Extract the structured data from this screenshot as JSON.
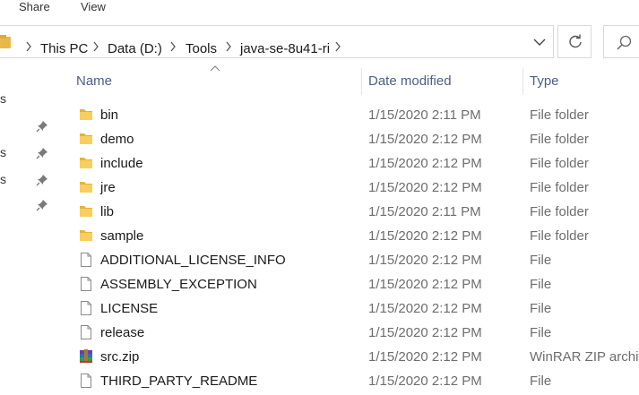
{
  "ribbon": {
    "tabs": [
      "Share",
      "View"
    ]
  },
  "address_bar": {
    "breadcrumbs": [
      "This PC",
      "Data (D:)",
      "Tools",
      "java-se-8u41-ri"
    ]
  },
  "nav_pane": {
    "partial_labels": [
      "s",
      "s",
      "s"
    ]
  },
  "columns": {
    "name": "Name",
    "date": "Date modified",
    "type": "Type"
  },
  "files": [
    {
      "name": "bin",
      "date": "1/15/2020 2:11 PM",
      "type": "File folder",
      "icon": "folder-icon"
    },
    {
      "name": "demo",
      "date": "1/15/2020 2:12 PM",
      "type": "File folder",
      "icon": "folder-icon"
    },
    {
      "name": "include",
      "date": "1/15/2020 2:12 PM",
      "type": "File folder",
      "icon": "folder-icon"
    },
    {
      "name": "jre",
      "date": "1/15/2020 2:12 PM",
      "type": "File folder",
      "icon": "folder-icon"
    },
    {
      "name": "lib",
      "date": "1/15/2020 2:11 PM",
      "type": "File folder",
      "icon": "folder-icon"
    },
    {
      "name": "sample",
      "date": "1/15/2020 2:12 PM",
      "type": "File folder",
      "icon": "folder-icon"
    },
    {
      "name": "ADDITIONAL_LICENSE_INFO",
      "date": "1/15/2020 2:12 PM",
      "type": "File",
      "icon": "file-icon"
    },
    {
      "name": "ASSEMBLY_EXCEPTION",
      "date": "1/15/2020 2:12 PM",
      "type": "File",
      "icon": "file-icon"
    },
    {
      "name": "LICENSE",
      "date": "1/15/2020 2:12 PM",
      "type": "File",
      "icon": "file-icon"
    },
    {
      "name": "release",
      "date": "1/15/2020 2:12 PM",
      "type": "File",
      "icon": "file-icon"
    },
    {
      "name": "src.zip",
      "date": "1/15/2020 2:12 PM",
      "type": "WinRAR ZIP archiv",
      "icon": "winrar-archive-icon"
    },
    {
      "name": "THIRD_PARTY_README",
      "date": "1/15/2020 2:12 PM",
      "type": "File",
      "icon": "file-icon"
    }
  ]
}
